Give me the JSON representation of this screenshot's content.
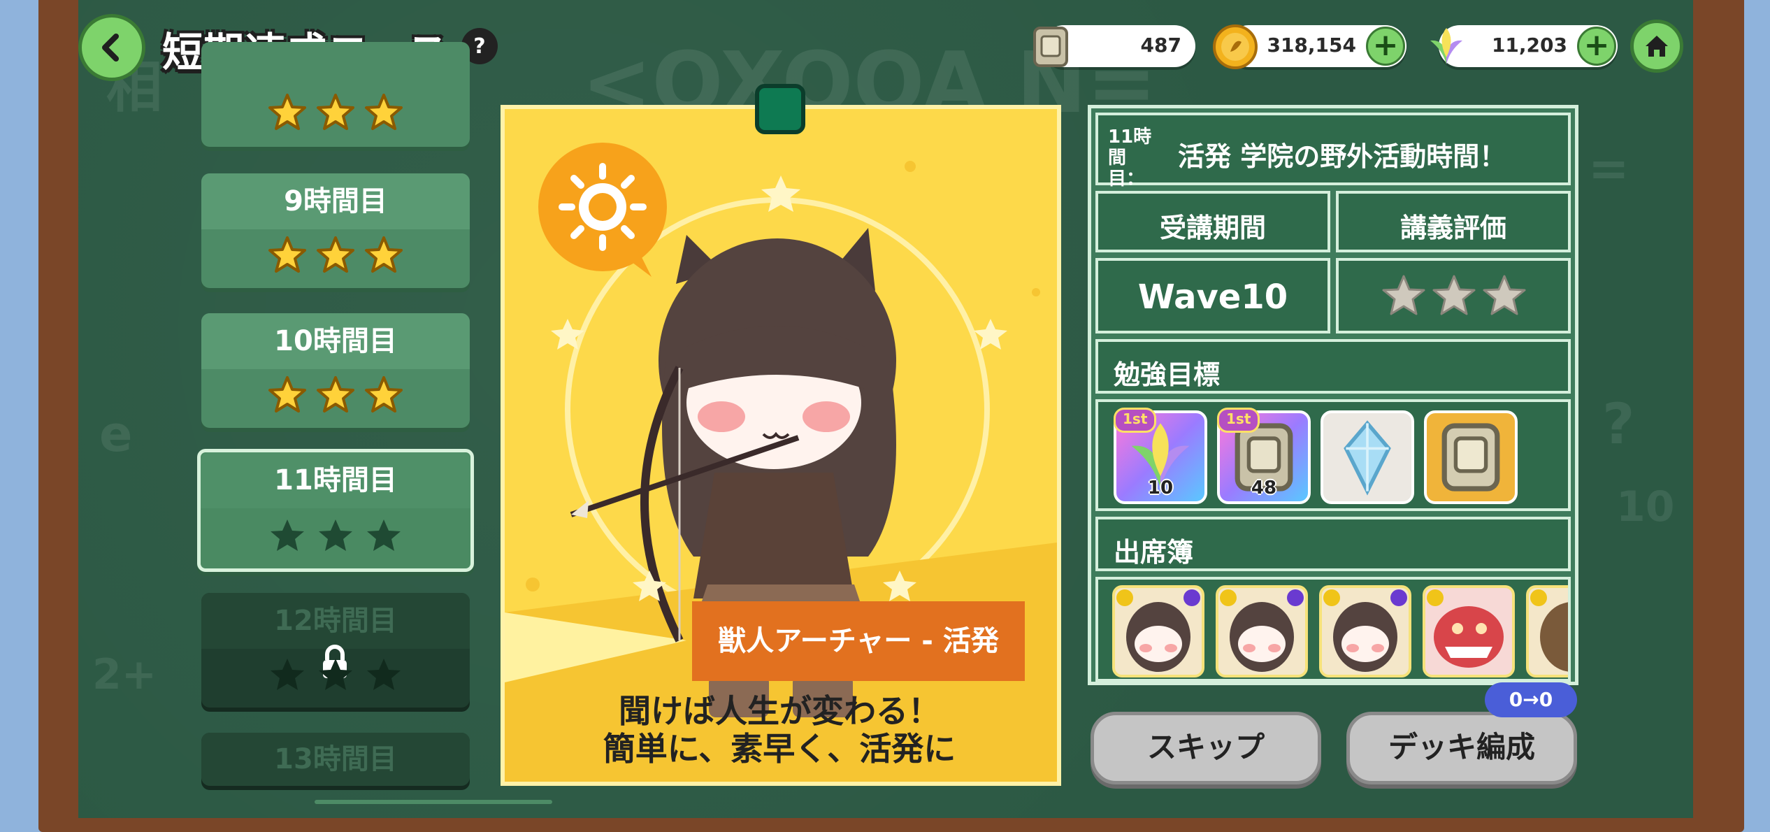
{
  "header": {
    "title": "短期速成コース",
    "help_label": "?",
    "currencies": [
      {
        "name": "ticket",
        "value": "487"
      },
      {
        "name": "gold-coin",
        "value": "318,154"
      },
      {
        "name": "rainbow-leaf",
        "value": "11,203"
      }
    ]
  },
  "lessons": [
    {
      "label": "",
      "stars": 3,
      "state": "done"
    },
    {
      "label": "9時間目",
      "stars": 3,
      "state": "done"
    },
    {
      "label": "10時間目",
      "stars": 3,
      "state": "done"
    },
    {
      "label": "11時間目",
      "stars": 0,
      "state": "selected"
    },
    {
      "label": "12時間目",
      "stars": 0,
      "state": "locked"
    },
    {
      "label": "13時間目",
      "stars": 0,
      "state": "locked"
    }
  ],
  "card": {
    "character_name": "獣人アーチャー - 活発",
    "slogan_line1": "聞けば人生が変わる！",
    "slogan_line2": "簡単に、素早く、活発に"
  },
  "info": {
    "lesson_prefix": "11時間目：",
    "lesson_title": "活発 学院の野外活動時間！",
    "period_header": "受講期間",
    "rating_header": "講義評価",
    "period_value": "Wave10",
    "rating_stars": 0,
    "goals_header": "勉強目標",
    "goals": [
      {
        "icon": "rainbow-leaf-icon",
        "badge": "1st",
        "qty": "10"
      },
      {
        "icon": "ticket-icon",
        "badge": "1st",
        "qty": "48"
      },
      {
        "icon": "crystal-icon",
        "badge": "",
        "qty": ""
      },
      {
        "icon": "gold-ticket-icon",
        "badge": "",
        "qty": ""
      }
    ],
    "attendance_header": "出席簿"
  },
  "actions": {
    "skip_label": "スキップ",
    "deck_label": "デッキ編成",
    "deck_badge": "0→0"
  },
  "colors": {
    "board": "#2c5944",
    "card_yellow": "#fdd94a",
    "name_orange": "#e2711f",
    "green_button": "#7ed36b"
  }
}
